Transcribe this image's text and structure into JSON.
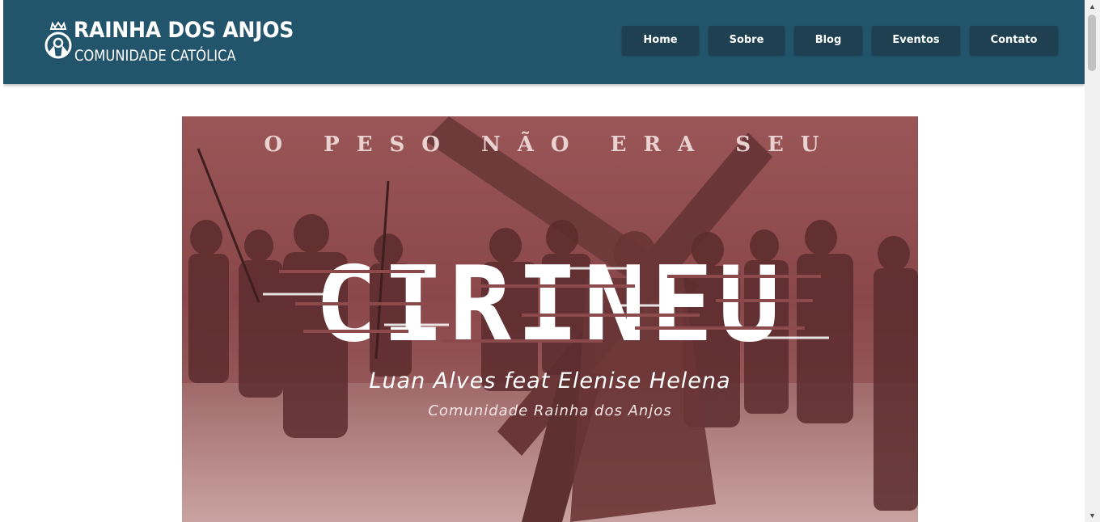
{
  "header": {
    "brand_title": "RAINHA DOS ANJOS",
    "brand_subtitle": "COMUNIDADE CATÓLICA",
    "logo_icon": "crowned-figure-icon"
  },
  "nav": {
    "items": [
      {
        "label": "Home"
      },
      {
        "label": "Sobre"
      },
      {
        "label": "Blog"
      },
      {
        "label": "Eventos"
      },
      {
        "label": "Contato"
      }
    ]
  },
  "banner": {
    "tagline": "O PESO NÃO ERA SEU",
    "title": "CIRINEU",
    "artist": "Luan Alves feat Elenise Helena",
    "community": "Comunidade Rainha dos Anjos"
  },
  "colors": {
    "header_bg": "#22546b",
    "nav_button_bg": "#1e4050",
    "banner_tint": "#8c4a4c"
  }
}
